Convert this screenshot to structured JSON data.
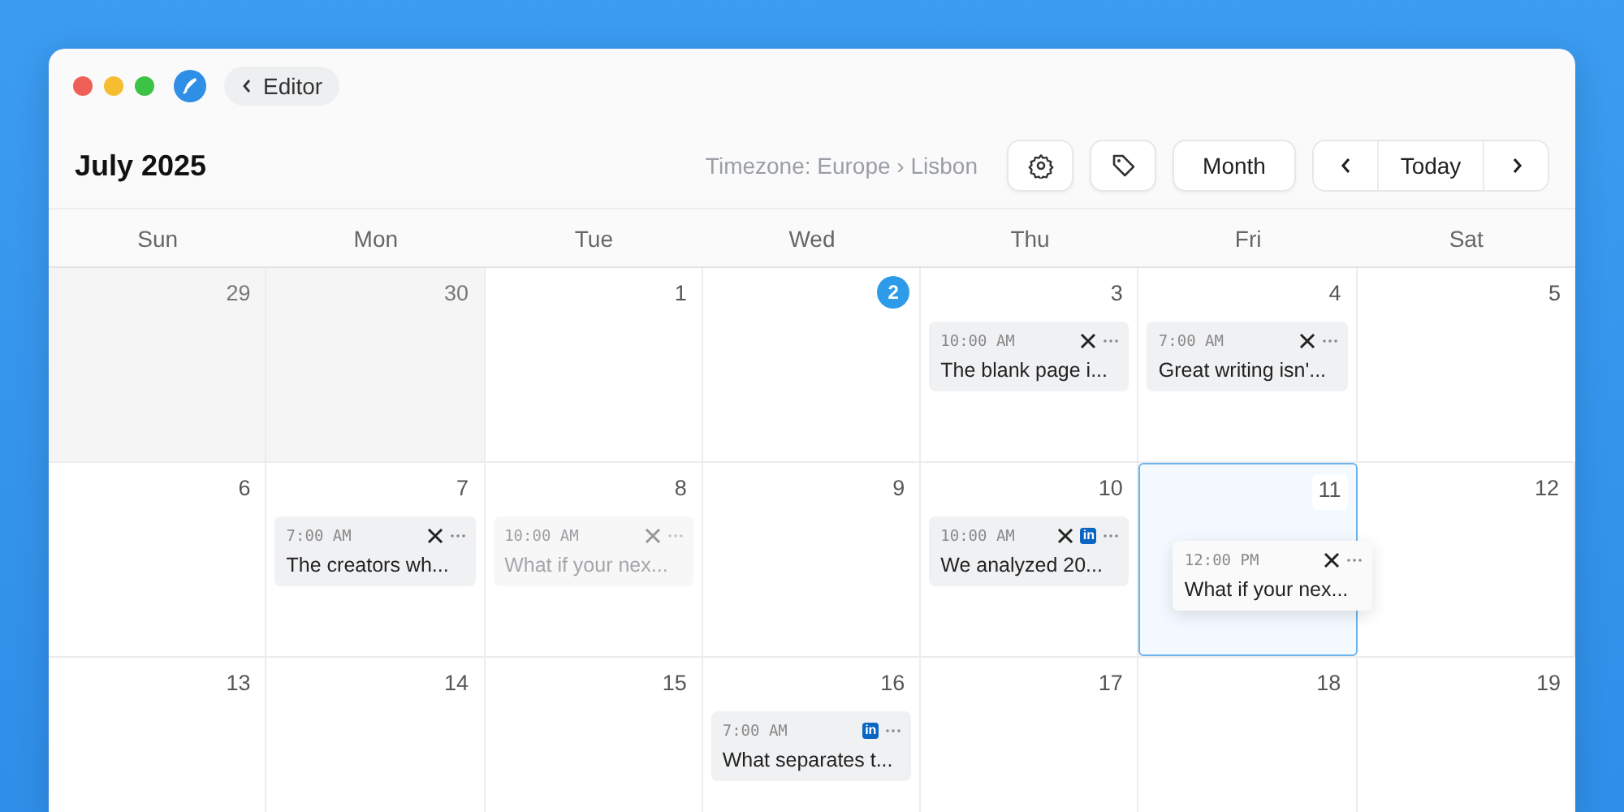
{
  "window": {
    "back_button": "Editor"
  },
  "header": {
    "title": "July 2025",
    "timezone": "Timezone: Europe › Lisbon",
    "view_button": "Month",
    "today_button": "Today"
  },
  "weekdays": [
    "Sun",
    "Mon",
    "Tue",
    "Wed",
    "Thu",
    "Fri",
    "Sat"
  ],
  "weeks": [
    {
      "days": [
        {
          "day": "29",
          "outside_month": true,
          "today": false,
          "highlighted": false
        },
        {
          "day": "30",
          "outside_month": true,
          "today": false,
          "highlighted": false
        },
        {
          "day": "1",
          "outside_month": false,
          "today": false,
          "highlighted": false
        },
        {
          "day": "2",
          "outside_month": false,
          "today": true,
          "highlighted": false
        },
        {
          "day": "3",
          "outside_month": false,
          "today": false,
          "highlighted": false,
          "posts": [
            {
              "kind": "normal",
              "time": "10:00 AM",
              "title": "The blank page i...",
              "platforms": [
                {
                  "kind": "x"
                }
              ]
            }
          ]
        },
        {
          "day": "4",
          "outside_month": false,
          "today": false,
          "highlighted": false,
          "posts": [
            {
              "kind": "normal",
              "time": "7:00 AM",
              "title": "Great writing isn'...",
              "platforms": [
                {
                  "kind": "x"
                }
              ]
            }
          ]
        },
        {
          "day": "5",
          "outside_month": false,
          "today": false,
          "highlighted": false
        }
      ]
    },
    {
      "days": [
        {
          "day": "6",
          "outside_month": false,
          "today": false,
          "highlighted": false
        },
        {
          "day": "7",
          "outside_month": false,
          "today": false,
          "highlighted": false,
          "posts": [
            {
              "kind": "normal",
              "time": "7:00 AM",
              "title": "The creators wh...",
              "platforms": [
                {
                  "kind": "x"
                }
              ]
            }
          ]
        },
        {
          "day": "8",
          "outside_month": false,
          "today": false,
          "highlighted": false,
          "posts": [
            {
              "kind": "ghost",
              "time": "10:00 AM",
              "title": "What if your nex...",
              "platforms": [
                {
                  "kind": "x"
                }
              ]
            }
          ]
        },
        {
          "day": "9",
          "outside_month": false,
          "today": false,
          "highlighted": false
        },
        {
          "day": "10",
          "outside_month": false,
          "today": false,
          "highlighted": false,
          "posts": [
            {
              "kind": "normal",
              "time": "10:00 AM",
              "title": "We analyzed 20...",
              "platforms": [
                {
                  "kind": "x"
                },
                {
                  "kind": "linkedin",
                  "label": "in"
                }
              ]
            }
          ]
        },
        {
          "day": "11",
          "outside_month": false,
          "today": false,
          "highlighted": true,
          "posts": [
            {
              "kind": "dragging",
              "time": "12:00 PM",
              "title": "What if your nex...",
              "platforms": [
                {
                  "kind": "x"
                }
              ]
            }
          ]
        },
        {
          "day": "12",
          "outside_month": false,
          "today": false,
          "highlighted": false
        }
      ]
    },
    {
      "days": [
        {
          "day": "13",
          "outside_month": false,
          "today": false,
          "highlighted": false
        },
        {
          "day": "14",
          "outside_month": false,
          "today": false,
          "highlighted": false
        },
        {
          "day": "15",
          "outside_month": false,
          "today": false,
          "highlighted": false
        },
        {
          "day": "16",
          "outside_month": false,
          "today": false,
          "highlighted": false,
          "posts": [
            {
              "kind": "normal",
              "time": "7:00 AM",
              "title": "What separates t...",
              "platforms": [
                {
                  "kind": "linkedin",
                  "label": "in"
                }
              ]
            }
          ]
        },
        {
          "day": "17",
          "outside_month": false,
          "today": false,
          "highlighted": false
        },
        {
          "day": "18",
          "outside_month": false,
          "today": false,
          "highlighted": false
        },
        {
          "day": "19",
          "outside_month": false,
          "today": false,
          "highlighted": false
        }
      ]
    }
  ]
}
